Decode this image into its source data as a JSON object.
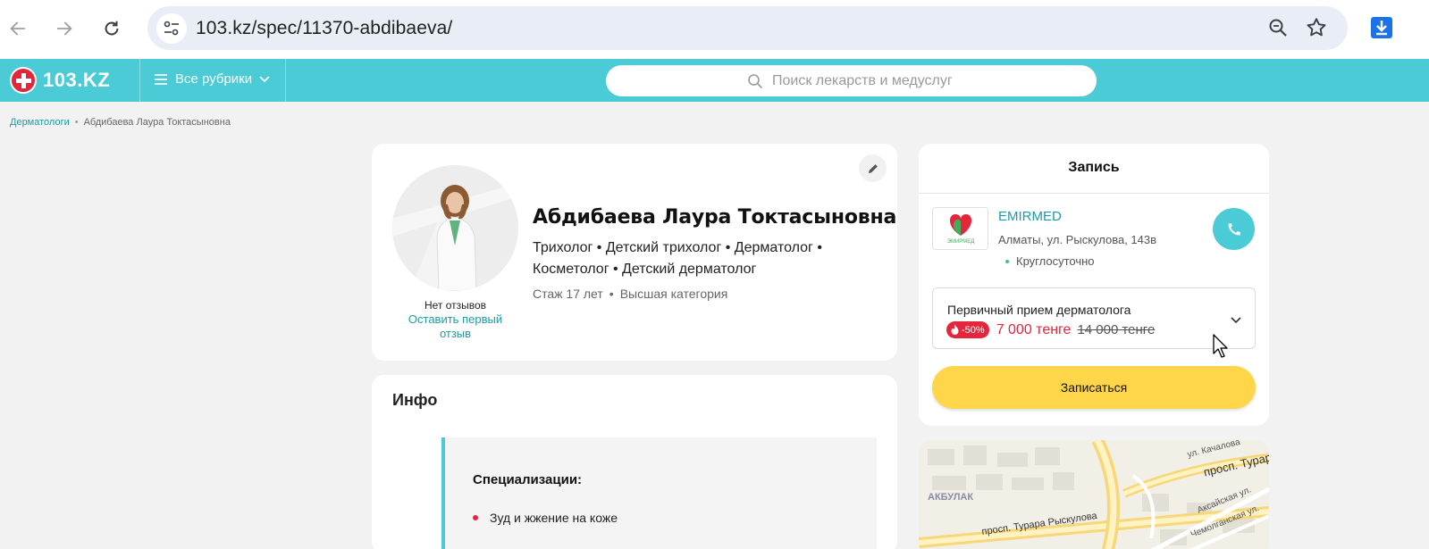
{
  "browser": {
    "url": "103.kz/spec/11370-abdibaeva/"
  },
  "header": {
    "logo_text": "103.KZ",
    "rubrics_label": "Все рубрики",
    "search_placeholder": "Поиск лекарств и медуслуг"
  },
  "breadcrumb": {
    "items": [
      "Дерматологи",
      "Абдибаева Лаура Токтасыновна"
    ]
  },
  "profile": {
    "name": "Абдибаева Лаура Токтасыновна",
    "specialties": "Трихолог • Детский трихолог • Дерматолог • Косметолог • Детский дерматолог",
    "experience": "Стаж 17 лет",
    "category": "Высшая категория",
    "meta_separator": "•",
    "reviews_status": "Нет отзывов",
    "leave_review": "Оставить первый отзыв"
  },
  "info": {
    "title": "Инфо",
    "specializations_title": "Специализации:",
    "specializations": [
      "Зуд и жжение на коже"
    ]
  },
  "booking": {
    "title": "Запись",
    "clinic_name": "EMIRMED",
    "clinic_logo_text": "ЭМИРМЕД",
    "clinic_address": "Алматы, ул. Рыскулова, 143в",
    "clinic_hours": "Круглосуточно",
    "service_name": "Первичный прием дерматолога",
    "discount": "-50%",
    "price_new": "7 000 тенге",
    "price_old": "14 000 тенге",
    "button_label": "Записаться"
  },
  "map": {
    "labels": [
      "ул. Качалова",
      "просп. Турар",
      "АКБУЛАК",
      "просп. Турара Рыскулова",
      "Аксайская ул.",
      "Чемолганская ул."
    ]
  },
  "colors": {
    "brand_teal": "#4acbd6",
    "brand_red": "#e4253b",
    "button_yellow": "#ffd54a",
    "link_teal": "#1e9aa6"
  }
}
